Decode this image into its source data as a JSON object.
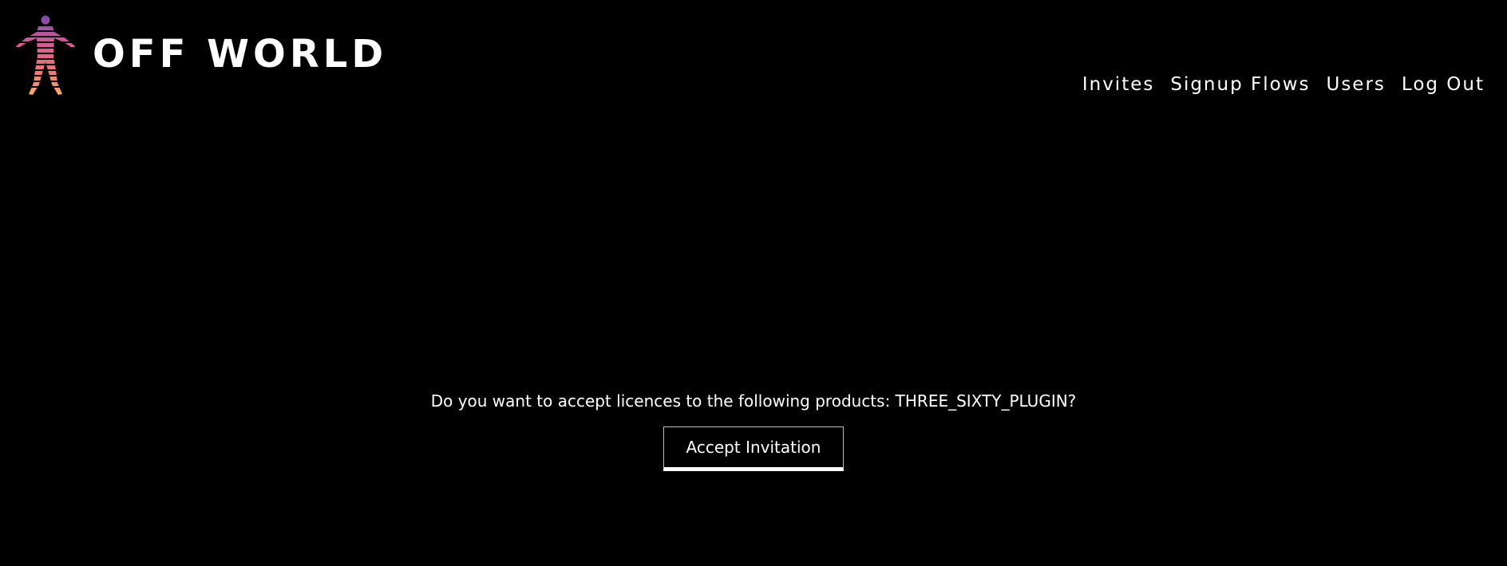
{
  "brand": {
    "name": "OFF WORLD",
    "logo_icon": "human-figure-icon",
    "colors": {
      "gradient_top": "#8a4fb0",
      "gradient_mid": "#e0608a",
      "gradient_bottom": "#f5a56a"
    }
  },
  "nav": {
    "items": [
      {
        "label": "Invites"
      },
      {
        "label": "Signup Flows"
      },
      {
        "label": "Users"
      },
      {
        "label": "Log Out"
      }
    ]
  },
  "main": {
    "prompt": "Do you want to accept licences to the following products: THREE_SIXTY_PLUGIN?",
    "accept_label": "Accept Invitation"
  },
  "theme": {
    "background": "#000000",
    "text": "#ffffff"
  }
}
